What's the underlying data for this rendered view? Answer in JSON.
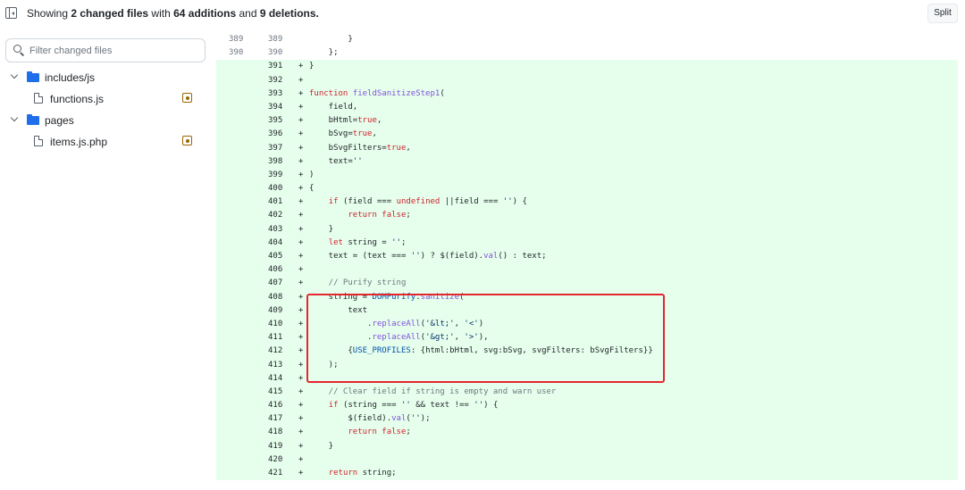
{
  "header": {
    "summary_prefix": "Showing",
    "changed_files": "2 changed files",
    "with_text": "with",
    "additions": "64 additions",
    "and_text": "and",
    "deletions": "9 deletions.",
    "split_label": "Split"
  },
  "sidebar": {
    "filter_placeholder": "Filter changed files",
    "tree": [
      {
        "type": "folder",
        "label": "includes/js"
      },
      {
        "type": "file",
        "label": "functions.js",
        "status": "modified"
      },
      {
        "type": "folder",
        "label": "pages"
      },
      {
        "type": "file",
        "label": "items.js.php",
        "status": "modified"
      }
    ]
  },
  "diff": {
    "context_lines": [
      {
        "old": "389",
        "new": "389",
        "code": "        }"
      },
      {
        "old": "390",
        "new": "390",
        "code": "    };"
      }
    ],
    "added_lines": [
      {
        "new": "391",
        "code": "}"
      },
      {
        "new": "392",
        "code": ""
      },
      {
        "new": "393",
        "code": "function fieldSanitizeStep1("
      },
      {
        "new": "394",
        "code": "    field,"
      },
      {
        "new": "395",
        "code": "    bHtml=true,"
      },
      {
        "new": "396",
        "code": "    bSvg=true,"
      },
      {
        "new": "397",
        "code": "    bSvgFilters=true,"
      },
      {
        "new": "398",
        "code": "    text=''"
      },
      {
        "new": "399",
        "code": ")"
      },
      {
        "new": "400",
        "code": "{"
      },
      {
        "new": "401",
        "code": "    if (field === undefined ||field === '') {"
      },
      {
        "new": "402",
        "code": "        return false;"
      },
      {
        "new": "403",
        "code": "    }"
      },
      {
        "new": "404",
        "code": "    let string = '';"
      },
      {
        "new": "405",
        "code": "    text = (text === '') ? $(field).val() : text;"
      },
      {
        "new": "406",
        "code": ""
      },
      {
        "new": "407",
        "code": "    // Purify string"
      },
      {
        "new": "408",
        "code": "    string = DOMPurify.sanitize("
      },
      {
        "new": "409",
        "code": "        text"
      },
      {
        "new": "410",
        "code": "            .replaceAll('&lt;', '<')"
      },
      {
        "new": "411",
        "code": "            .replaceAll('&gt;', '>'),"
      },
      {
        "new": "412",
        "code": "        {USE_PROFILES: {html:bHtml, svg:bSvg, svgFilters: bSvgFilters}}"
      },
      {
        "new": "413",
        "code": "    );"
      },
      {
        "new": "414",
        "code": ""
      },
      {
        "new": "415",
        "code": "    // Clear field if string is empty and warn user"
      },
      {
        "new": "416",
        "code": "    if (string === '' && text !== '') {"
      },
      {
        "new": "417",
        "code": "        $(field).val('');"
      },
      {
        "new": "418",
        "code": "        return false;"
      },
      {
        "new": "419",
        "code": "    }"
      },
      {
        "new": "420",
        "code": ""
      },
      {
        "new": "421",
        "code": "    return string;"
      }
    ],
    "added_sign": "+",
    "highlight_color": "#e5262f"
  }
}
